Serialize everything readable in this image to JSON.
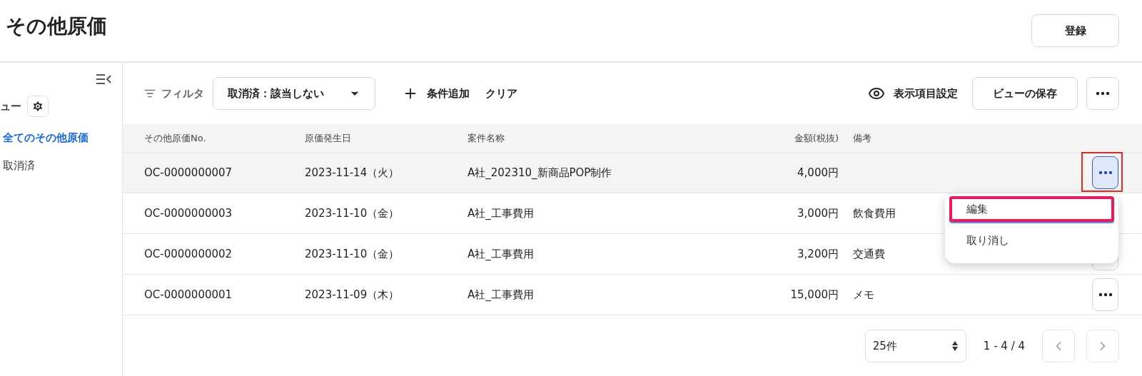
{
  "page": {
    "title": "その他原価",
    "register_button": "登録"
  },
  "sidebar": {
    "section_label": "ュー",
    "items": [
      {
        "label": "全てのその他原価",
        "selected": true
      },
      {
        "label": "取消済",
        "selected": false
      }
    ]
  },
  "toolbar": {
    "filter_label": "フィルタ",
    "filter_chip": "取消済：該当しない",
    "add_condition": "条件追加",
    "clear": "クリア",
    "display_settings": "表示項目設定",
    "save_view": "ビューの保存"
  },
  "table": {
    "columns": [
      "その他原価No.",
      "原価発生日",
      "案件名称",
      "金額(税抜)",
      "備考"
    ],
    "rows": [
      {
        "cells": [
          "OC-0000000007",
          "2023-11-14（火）",
          "A社_202310_新商品POP制作",
          "4,000円",
          ""
        ],
        "menu_open": true
      },
      {
        "cells": [
          "OC-0000000003",
          "2023-11-10（金）",
          "A社_工事費用",
          "3,000円",
          "飲食費用"
        ],
        "menu_open": false
      },
      {
        "cells": [
          "OC-0000000002",
          "2023-11-10（金）",
          "A社_工事費用",
          "3,200円",
          "交通費"
        ],
        "menu_open": false
      },
      {
        "cells": [
          "OC-0000000001",
          "2023-11-09（木）",
          "A社_工事費用",
          "15,000円",
          "メモ"
        ],
        "menu_open": false
      }
    ]
  },
  "row_menu": {
    "items": [
      {
        "label": "編集",
        "selected": true
      },
      {
        "label": "取り消し",
        "selected": false
      }
    ]
  },
  "pagination": {
    "page_size": "25件",
    "range": "1 - 4 / 4"
  }
}
